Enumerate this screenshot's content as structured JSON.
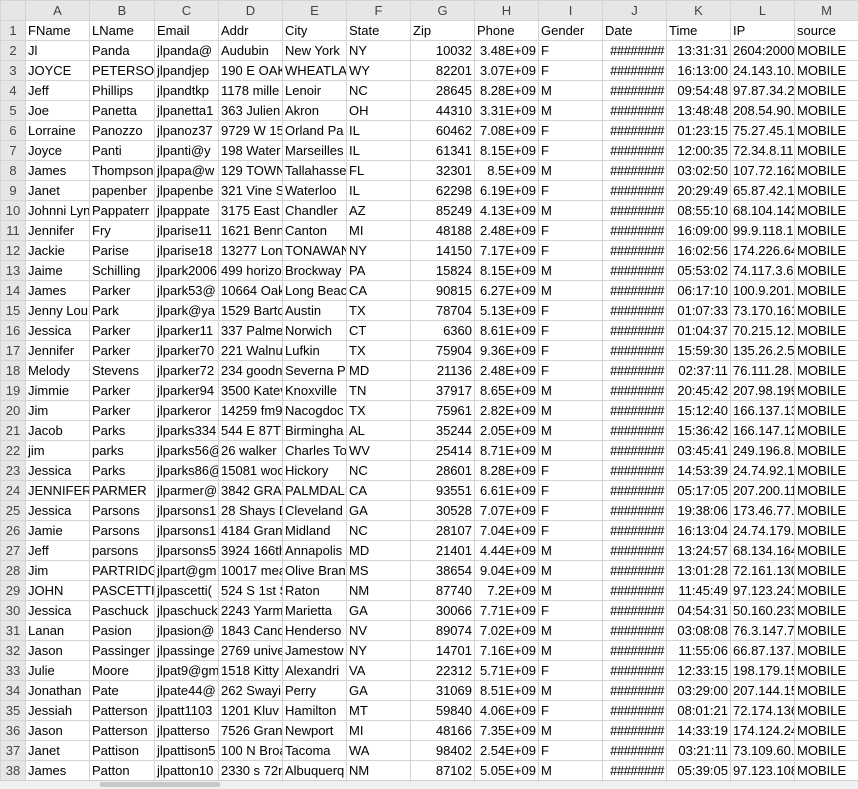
{
  "columns": [
    "A",
    "B",
    "C",
    "D",
    "E",
    "F",
    "G",
    "H",
    "I",
    "J",
    "K",
    "L",
    "M"
  ],
  "rows": [
    {
      "n": "1",
      "c": [
        "FName",
        "LName",
        "Email",
        "Addr",
        "City",
        "State",
        "Zip",
        "Phone",
        "Gender",
        "Date",
        "Time",
        "IP",
        "source"
      ]
    },
    {
      "n": "2",
      "c": [
        "Jl",
        "Panda",
        "jlpanda@",
        "Audubin",
        "New York",
        "NY",
        "10032",
        "3.48E+09",
        "F",
        "########",
        "13:31:31",
        "2604:2000",
        "MOBILE"
      ]
    },
    {
      "n": "3",
      "c": [
        "JOYCE",
        "PETERSON",
        "jlpandjep",
        "190 E OAK",
        "WHEATLA",
        "WY",
        "82201",
        "3.07E+09",
        "F",
        "########",
        "16:13:00",
        "24.143.10.",
        "MOBILE"
      ]
    },
    {
      "n": "4",
      "c": [
        "Jeff",
        "Phillips",
        "jlpandtkp",
        "1178 mille",
        "Lenoir",
        "NC",
        "28645",
        "8.28E+09",
        "M",
        "########",
        "09:54:48",
        "97.87.34.2",
        "MOBILE"
      ]
    },
    {
      "n": "5",
      "c": [
        "Joe",
        "Panetta",
        "jlpanetta1",
        "363 Julien",
        "Akron",
        "OH",
        "44310",
        "3.31E+09",
        "M",
        "########",
        "13:48:48",
        "208.54.90.",
        "MOBILE"
      ]
    },
    {
      "n": "6",
      "c": [
        "Lorraine",
        "Panozzo",
        "jlpanoz37",
        "9729 W 15",
        "Orland Pa",
        "IL",
        "60462",
        "7.08E+09",
        "F",
        "########",
        "01:23:15",
        "75.27.45.1",
        "MOBILE"
      ]
    },
    {
      "n": "7",
      "c": [
        "Joyce",
        "Panti",
        "jlpanti@y",
        "198 Water",
        "Marseilles",
        "IL",
        "61341",
        "8.15E+09",
        "F",
        "########",
        "12:00:35",
        "72.34.8.11",
        "MOBILE"
      ]
    },
    {
      "n": "8",
      "c": [
        "James",
        "Thompson",
        "jlpapa@w",
        "129 TOWN",
        "Tallahasse",
        "FL",
        "32301",
        "8.5E+09",
        "M",
        "########",
        "03:02:50",
        "107.72.162",
        "MOBILE"
      ]
    },
    {
      "n": "9",
      "c": [
        "Janet",
        "papenber",
        "jlpapenbe",
        "321 Vine S",
        "Waterloo",
        "IL",
        "62298",
        "6.19E+09",
        "F",
        "########",
        "20:29:49",
        "65.87.42.1",
        "MOBILE"
      ]
    },
    {
      "n": "10",
      "c": [
        "Johnni Lyn",
        "Pappaterr",
        "jlpappate",
        "3175 East",
        "Chandler",
        "AZ",
        "85249",
        "4.13E+09",
        "M",
        "########",
        "08:55:10",
        "68.104.142",
        "MOBILE"
      ]
    },
    {
      "n": "11",
      "c": [
        "Jennifer",
        "Fry",
        "jlparise11",
        "1621 Benn",
        "Canton",
        "MI",
        "48188",
        "2.48E+09",
        "F",
        "########",
        "16:09:00",
        "99.9.118.1",
        "MOBILE"
      ]
    },
    {
      "n": "12",
      "c": [
        "Jackie",
        "Parise",
        "jlparise18",
        "13277 Lon",
        "TONAWAN",
        "NY",
        "14150",
        "7.17E+09",
        "F",
        "########",
        "16:02:56",
        "174.226.64",
        "MOBILE"
      ]
    },
    {
      "n": "13",
      "c": [
        "Jaime",
        "Schilling",
        "jlpark2006",
        "499 horizo",
        "Brockway",
        "PA",
        "15824",
        "8.15E+09",
        "M",
        "########",
        "05:53:02",
        "74.117.3.6",
        "MOBILE"
      ]
    },
    {
      "n": "14",
      "c": [
        "James",
        "Parker",
        "jlpark53@",
        "10664 Oak",
        "Long Beac",
        "CA",
        "90815",
        "6.27E+09",
        "M",
        "########",
        "06:17:10",
        "100.9.201.",
        "MOBILE"
      ]
    },
    {
      "n": "15",
      "c": [
        "Jenny Lou",
        "Park",
        "jlpark@ya",
        "1529 Barto",
        "Austin",
        "TX",
        "78704",
        "5.13E+09",
        "F",
        "########",
        "01:07:33",
        "73.170.161",
        "MOBILE"
      ]
    },
    {
      "n": "16",
      "c": [
        "Jessica",
        "Parker",
        "jlparker11",
        "337 Palme",
        "Norwich",
        "CT",
        "6360",
        "8.61E+09",
        "F",
        "########",
        "01:04:37",
        "70.215.12.",
        "MOBILE"
      ]
    },
    {
      "n": "17",
      "c": [
        "Jennifer",
        "Parker",
        "jlparker70",
        "221 Walnu",
        "Lufkin",
        "TX",
        "75904",
        "9.36E+09",
        "F",
        "########",
        "15:59:30",
        "135.26.2.5",
        "MOBILE"
      ]
    },
    {
      "n": "18",
      "c": [
        "Melody",
        "Stevens",
        "jlparker72",
        "234 goodn",
        "Severna P",
        "MD",
        "21136",
        "2.48E+09",
        "F",
        "########",
        "02:37:11",
        "76.111.28.",
        "MOBILE"
      ]
    },
    {
      "n": "19",
      "c": [
        "Jimmie",
        "Parker",
        "jlparker94",
        "3500 Katev",
        "Knoxville",
        "TN",
        "37917",
        "8.65E+09",
        "M",
        "########",
        "20:45:42",
        "207.98.199",
        "MOBILE"
      ]
    },
    {
      "n": "20",
      "c": [
        "Jim",
        "Parker",
        "jlparkeror",
        "14259 fm9",
        "Nacogdoc",
        "TX",
        "75961",
        "2.82E+09",
        "M",
        "########",
        "15:12:40",
        "166.137.13",
        "MOBILE"
      ]
    },
    {
      "n": "21",
      "c": [
        "Jacob",
        "Parks",
        "jlparks334",
        "544 E 87TH",
        "Birmingha",
        "AL",
        "35244",
        "2.05E+09",
        "M",
        "########",
        "15:36:42",
        "166.147.12",
        "MOBILE"
      ]
    },
    {
      "n": "22",
      "c": [
        "jim",
        "parks",
        "jlparks56@",
        "26 walker",
        "Charles To",
        "WV",
        "25414",
        "8.71E+09",
        "M",
        "########",
        "03:45:41",
        "249.196.8.",
        "MOBILE"
      ]
    },
    {
      "n": "23",
      "c": [
        "Jessica",
        "Parks",
        "jlparks86@",
        "15081 woo",
        "Hickory",
        "NC",
        "28601",
        "8.28E+09",
        "F",
        "########",
        "14:53:39",
        "24.74.92.1",
        "MOBILE"
      ]
    },
    {
      "n": "24",
      "c": [
        "JENNIFER",
        "PARMER",
        "jlparmer@",
        "3842 GRAI",
        "PALMDALI",
        "CA",
        "93551",
        "6.61E+09",
        "F",
        "########",
        "05:17:05",
        "207.200.11",
        "MOBILE"
      ]
    },
    {
      "n": "25",
      "c": [
        "Jessica",
        "Parsons",
        "jlparsons1",
        "28 Shays D",
        "Cleveland",
        "GA",
        "30528",
        "7.07E+09",
        "F",
        "########",
        "19:38:06",
        "173.46.77.",
        "MOBILE"
      ]
    },
    {
      "n": "26",
      "c": [
        "Jamie",
        "Parsons",
        "jlparsons1",
        "4184 Gran",
        "Midland",
        "NC",
        "28107",
        "7.04E+09",
        "F",
        "########",
        "16:13:04",
        "24.74.179.",
        "MOBILE"
      ]
    },
    {
      "n": "27",
      "c": [
        "Jeff",
        "parsons",
        "jlparsons5",
        "3924 166th",
        "Annapolis",
        "MD",
        "21401",
        "4.44E+09",
        "M",
        "########",
        "13:24:57",
        "68.134.164",
        "MOBILE"
      ]
    },
    {
      "n": "28",
      "c": [
        "Jim",
        "PARTRIDG",
        "jlpart@gm",
        "10017 mea",
        "Olive Bran",
        "MS",
        "38654",
        "9.04E+09",
        "M",
        "########",
        "13:01:28",
        "72.161.130",
        "MOBILE"
      ]
    },
    {
      "n": "29",
      "c": [
        "JOHN",
        "PASCETTI",
        "jlpascetti(",
        "524 S 1st S",
        "Raton",
        "NM",
        "87740",
        "7.2E+09",
        "M",
        "########",
        "11:45:49",
        "97.123.241",
        "MOBILE"
      ]
    },
    {
      "n": "30",
      "c": [
        "Jessica",
        "Paschuck",
        "jlpaschuck",
        "2243 Yarm",
        "Marietta",
        "GA",
        "30066",
        "7.71E+09",
        "F",
        "########",
        "04:54:31",
        "50.160.233",
        "MOBILE"
      ]
    },
    {
      "n": "31",
      "c": [
        "Lanan",
        "Pasion",
        "jlpasion@",
        "1843 Cand",
        "Henderso",
        "NV",
        "89074",
        "7.02E+09",
        "M",
        "########",
        "03:08:08",
        "76.3.147.7",
        "MOBILE"
      ]
    },
    {
      "n": "32",
      "c": [
        "Jason",
        "Passinger",
        "jlpassinge",
        "2769 unive",
        "Jamestow",
        "NY",
        "14701",
        "7.16E+09",
        "M",
        "########",
        "11:55:06",
        "66.87.137.",
        "MOBILE"
      ]
    },
    {
      "n": "33",
      "c": [
        "Julie",
        "Moore",
        "jlpat9@gm",
        "1518 Kitty",
        "Alexandri",
        "VA",
        "22312",
        "5.71E+09",
        "F",
        "########",
        "12:33:15",
        "198.179.15",
        "MOBILE"
      ]
    },
    {
      "n": "34",
      "c": [
        "Jonathan",
        "Pate",
        "jlpate44@",
        "262 Swayi",
        "Perry",
        "GA",
        "31069",
        "8.51E+09",
        "M",
        "########",
        "03:29:00",
        "207.144.15",
        "MOBILE"
      ]
    },
    {
      "n": "35",
      "c": [
        "Jessiah",
        "Patterson",
        "jlpatt1103",
        "1201 Kluv",
        "Hamilton",
        "MT",
        "59840",
        "4.06E+09",
        "F",
        "########",
        "08:01:21",
        "72.174.136",
        "MOBILE"
      ]
    },
    {
      "n": "36",
      "c": [
        "Jason",
        "Patterson",
        "jlpatterso",
        "7526 Grant",
        "Newport",
        "MI",
        "48166",
        "7.35E+09",
        "M",
        "########",
        "14:33:19",
        "174.124.24",
        "MOBILE"
      ]
    },
    {
      "n": "37",
      "c": [
        "Janet",
        "Pattison",
        "jlpattison5",
        "100 N Broa",
        "Tacoma",
        "WA",
        "98402",
        "2.54E+09",
        "F",
        "########",
        "03:21:11",
        "73.109.60.",
        "MOBILE"
      ]
    },
    {
      "n": "38",
      "c": [
        "James",
        "Patton",
        "jlpatton10",
        "2330 s 72n",
        "Albuquerq",
        "NM",
        "87102",
        "5.05E+09",
        "M",
        "########",
        "05:39:05",
        "97.123.108",
        "MOBILE"
      ]
    }
  ]
}
